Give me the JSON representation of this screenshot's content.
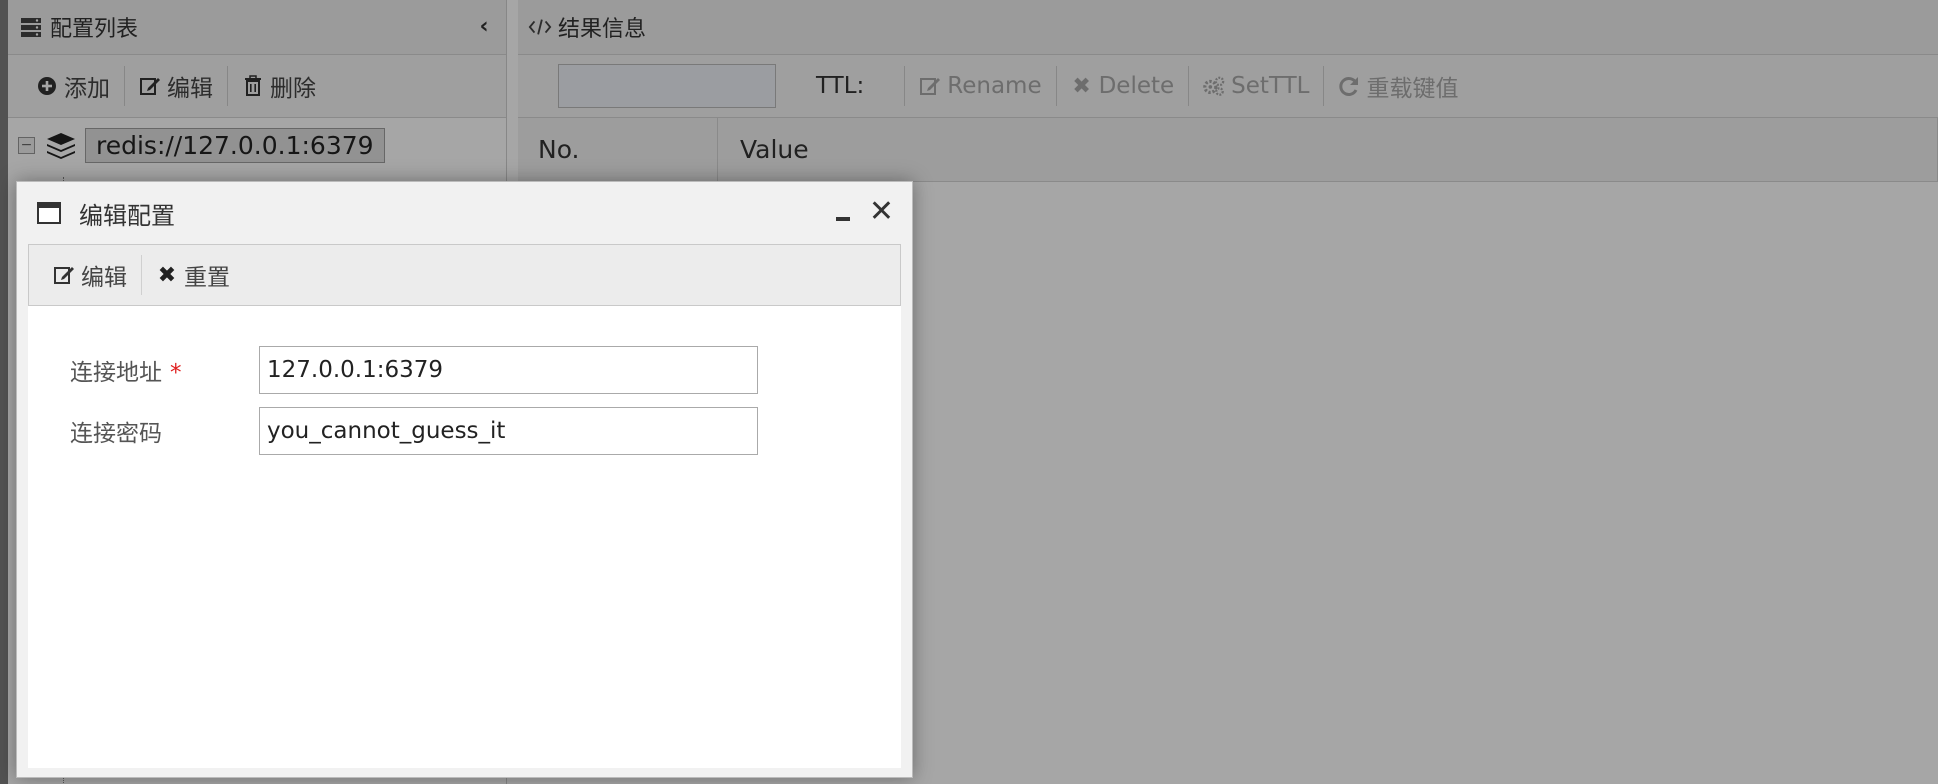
{
  "left_panel": {
    "title": "配置列表",
    "toolbar": {
      "add_label": "添加",
      "edit_label": "编辑",
      "delete_label": "删除"
    },
    "tree": {
      "connection_label": "redis://127.0.0.1:6379",
      "toggle_symbol": "−"
    }
  },
  "right_panel": {
    "title": "结果信息",
    "toolbar": {
      "key_value": "",
      "ttl_label": "TTL:",
      "rename_label": "Rename",
      "delete_label": "Delete",
      "setttl_label": "SetTTL",
      "reload_label": "重载键值"
    },
    "table": {
      "col_no": "No.",
      "col_value": "Value"
    }
  },
  "dialog": {
    "title": "编辑配置",
    "toolbar": {
      "edit_label": "编辑",
      "reset_label": "重置"
    },
    "fields": {
      "address_label": "连接地址",
      "address_required": "*",
      "address_value": "127.0.0.1:6379",
      "password_label": "连接密码",
      "password_value": "you_cannot_guess_it"
    }
  },
  "colors": {
    "required": "#e02020",
    "disabled_text": "#a8a8a8"
  }
}
